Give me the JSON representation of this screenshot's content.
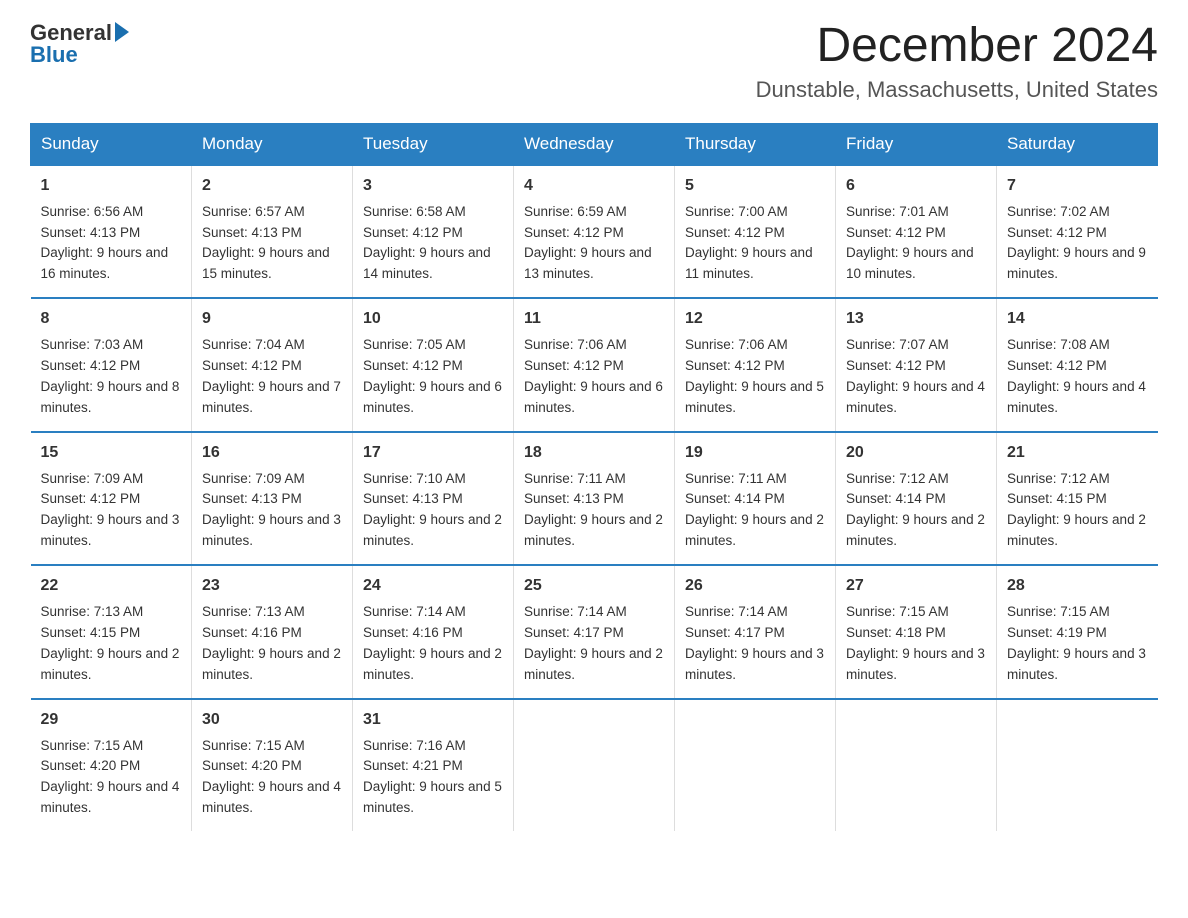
{
  "logo": {
    "text_general": "General",
    "text_blue": "Blue"
  },
  "header": {
    "month": "December 2024",
    "location": "Dunstable, Massachusetts, United States"
  },
  "days_of_week": [
    "Sunday",
    "Monday",
    "Tuesday",
    "Wednesday",
    "Thursday",
    "Friday",
    "Saturday"
  ],
  "weeks": [
    [
      {
        "day": "1",
        "sunrise": "6:56 AM",
        "sunset": "4:13 PM",
        "daylight": "9 hours and 16 minutes."
      },
      {
        "day": "2",
        "sunrise": "6:57 AM",
        "sunset": "4:13 PM",
        "daylight": "9 hours and 15 minutes."
      },
      {
        "day": "3",
        "sunrise": "6:58 AM",
        "sunset": "4:12 PM",
        "daylight": "9 hours and 14 minutes."
      },
      {
        "day": "4",
        "sunrise": "6:59 AM",
        "sunset": "4:12 PM",
        "daylight": "9 hours and 13 minutes."
      },
      {
        "day": "5",
        "sunrise": "7:00 AM",
        "sunset": "4:12 PM",
        "daylight": "9 hours and 11 minutes."
      },
      {
        "day": "6",
        "sunrise": "7:01 AM",
        "sunset": "4:12 PM",
        "daylight": "9 hours and 10 minutes."
      },
      {
        "day": "7",
        "sunrise": "7:02 AM",
        "sunset": "4:12 PM",
        "daylight": "9 hours and 9 minutes."
      }
    ],
    [
      {
        "day": "8",
        "sunrise": "7:03 AM",
        "sunset": "4:12 PM",
        "daylight": "9 hours and 8 minutes."
      },
      {
        "day": "9",
        "sunrise": "7:04 AM",
        "sunset": "4:12 PM",
        "daylight": "9 hours and 7 minutes."
      },
      {
        "day": "10",
        "sunrise": "7:05 AM",
        "sunset": "4:12 PM",
        "daylight": "9 hours and 6 minutes."
      },
      {
        "day": "11",
        "sunrise": "7:06 AM",
        "sunset": "4:12 PM",
        "daylight": "9 hours and 6 minutes."
      },
      {
        "day": "12",
        "sunrise": "7:06 AM",
        "sunset": "4:12 PM",
        "daylight": "9 hours and 5 minutes."
      },
      {
        "day": "13",
        "sunrise": "7:07 AM",
        "sunset": "4:12 PM",
        "daylight": "9 hours and 4 minutes."
      },
      {
        "day": "14",
        "sunrise": "7:08 AM",
        "sunset": "4:12 PM",
        "daylight": "9 hours and 4 minutes."
      }
    ],
    [
      {
        "day": "15",
        "sunrise": "7:09 AM",
        "sunset": "4:12 PM",
        "daylight": "9 hours and 3 minutes."
      },
      {
        "day": "16",
        "sunrise": "7:09 AM",
        "sunset": "4:13 PM",
        "daylight": "9 hours and 3 minutes."
      },
      {
        "day": "17",
        "sunrise": "7:10 AM",
        "sunset": "4:13 PM",
        "daylight": "9 hours and 2 minutes."
      },
      {
        "day": "18",
        "sunrise": "7:11 AM",
        "sunset": "4:13 PM",
        "daylight": "9 hours and 2 minutes."
      },
      {
        "day": "19",
        "sunrise": "7:11 AM",
        "sunset": "4:14 PM",
        "daylight": "9 hours and 2 minutes."
      },
      {
        "day": "20",
        "sunrise": "7:12 AM",
        "sunset": "4:14 PM",
        "daylight": "9 hours and 2 minutes."
      },
      {
        "day": "21",
        "sunrise": "7:12 AM",
        "sunset": "4:15 PM",
        "daylight": "9 hours and 2 minutes."
      }
    ],
    [
      {
        "day": "22",
        "sunrise": "7:13 AM",
        "sunset": "4:15 PM",
        "daylight": "9 hours and 2 minutes."
      },
      {
        "day": "23",
        "sunrise": "7:13 AM",
        "sunset": "4:16 PM",
        "daylight": "9 hours and 2 minutes."
      },
      {
        "day": "24",
        "sunrise": "7:14 AM",
        "sunset": "4:16 PM",
        "daylight": "9 hours and 2 minutes."
      },
      {
        "day": "25",
        "sunrise": "7:14 AM",
        "sunset": "4:17 PM",
        "daylight": "9 hours and 2 minutes."
      },
      {
        "day": "26",
        "sunrise": "7:14 AM",
        "sunset": "4:17 PM",
        "daylight": "9 hours and 3 minutes."
      },
      {
        "day": "27",
        "sunrise": "7:15 AM",
        "sunset": "4:18 PM",
        "daylight": "9 hours and 3 minutes."
      },
      {
        "day": "28",
        "sunrise": "7:15 AM",
        "sunset": "4:19 PM",
        "daylight": "9 hours and 3 minutes."
      }
    ],
    [
      {
        "day": "29",
        "sunrise": "7:15 AM",
        "sunset": "4:20 PM",
        "daylight": "9 hours and 4 minutes."
      },
      {
        "day": "30",
        "sunrise": "7:15 AM",
        "sunset": "4:20 PM",
        "daylight": "9 hours and 4 minutes."
      },
      {
        "day": "31",
        "sunrise": "7:16 AM",
        "sunset": "4:21 PM",
        "daylight": "9 hours and 5 minutes."
      },
      null,
      null,
      null,
      null
    ]
  ]
}
